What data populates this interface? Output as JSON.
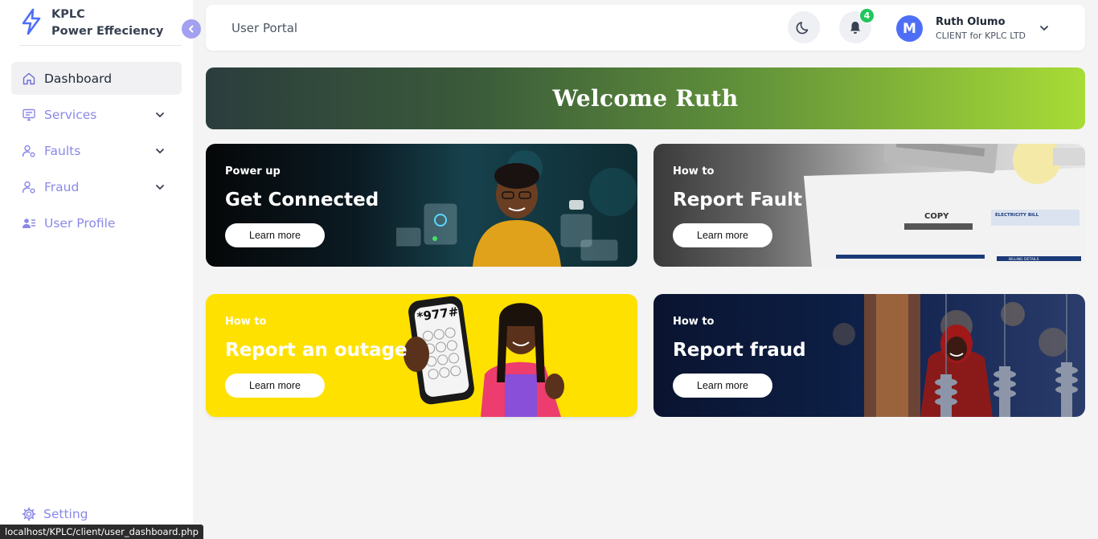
{
  "brand": {
    "line1": "KPLC",
    "line2": "Power Effeciency"
  },
  "sidebar": {
    "items": [
      {
        "label": "Dashboard",
        "icon": "home-icon"
      },
      {
        "label": "Services",
        "icon": "services-icon"
      },
      {
        "label": "Faults",
        "icon": "faults-icon"
      },
      {
        "label": "Fraud",
        "icon": "fraud-icon"
      },
      {
        "label": "User Profile",
        "icon": "user-profile-icon"
      }
    ],
    "settings_label": "Setting"
  },
  "header": {
    "title": "User Portal",
    "notifications_count": "4",
    "avatar_initial": "M",
    "user_name": "Ruth Olumo",
    "user_role": "CLIENT for KPLC LTD"
  },
  "welcome": {
    "text": "Welcome Ruth",
    "gradient_start": "#2b3d3d",
    "gradient_end": "#a8dc36"
  },
  "cards": [
    {
      "kicker": "Power up",
      "title": "Get Connected",
      "button": "Learn more"
    },
    {
      "kicker": "How to",
      "title": "Report Fault",
      "button": "Learn more"
    },
    {
      "kicker": "How to",
      "title": "Report an outage",
      "button": "Learn more",
      "phone_text": "*977#"
    },
    {
      "kicker": "How to",
      "title": "Report fraud",
      "button": "Learn more"
    }
  ],
  "card2_doc": {
    "copy": "COPY",
    "bill_title": "ELECTRICITY BILL",
    "billing_details": "BILLING DETAILS"
  },
  "status_bar": {
    "url": "localhost/KPLC/client/user_dashboard.php"
  },
  "colors": {
    "accent": "#8b88e8",
    "avatar": "#4f6ef7",
    "badge": "#22c55e",
    "outage_card": "#ffe100"
  }
}
